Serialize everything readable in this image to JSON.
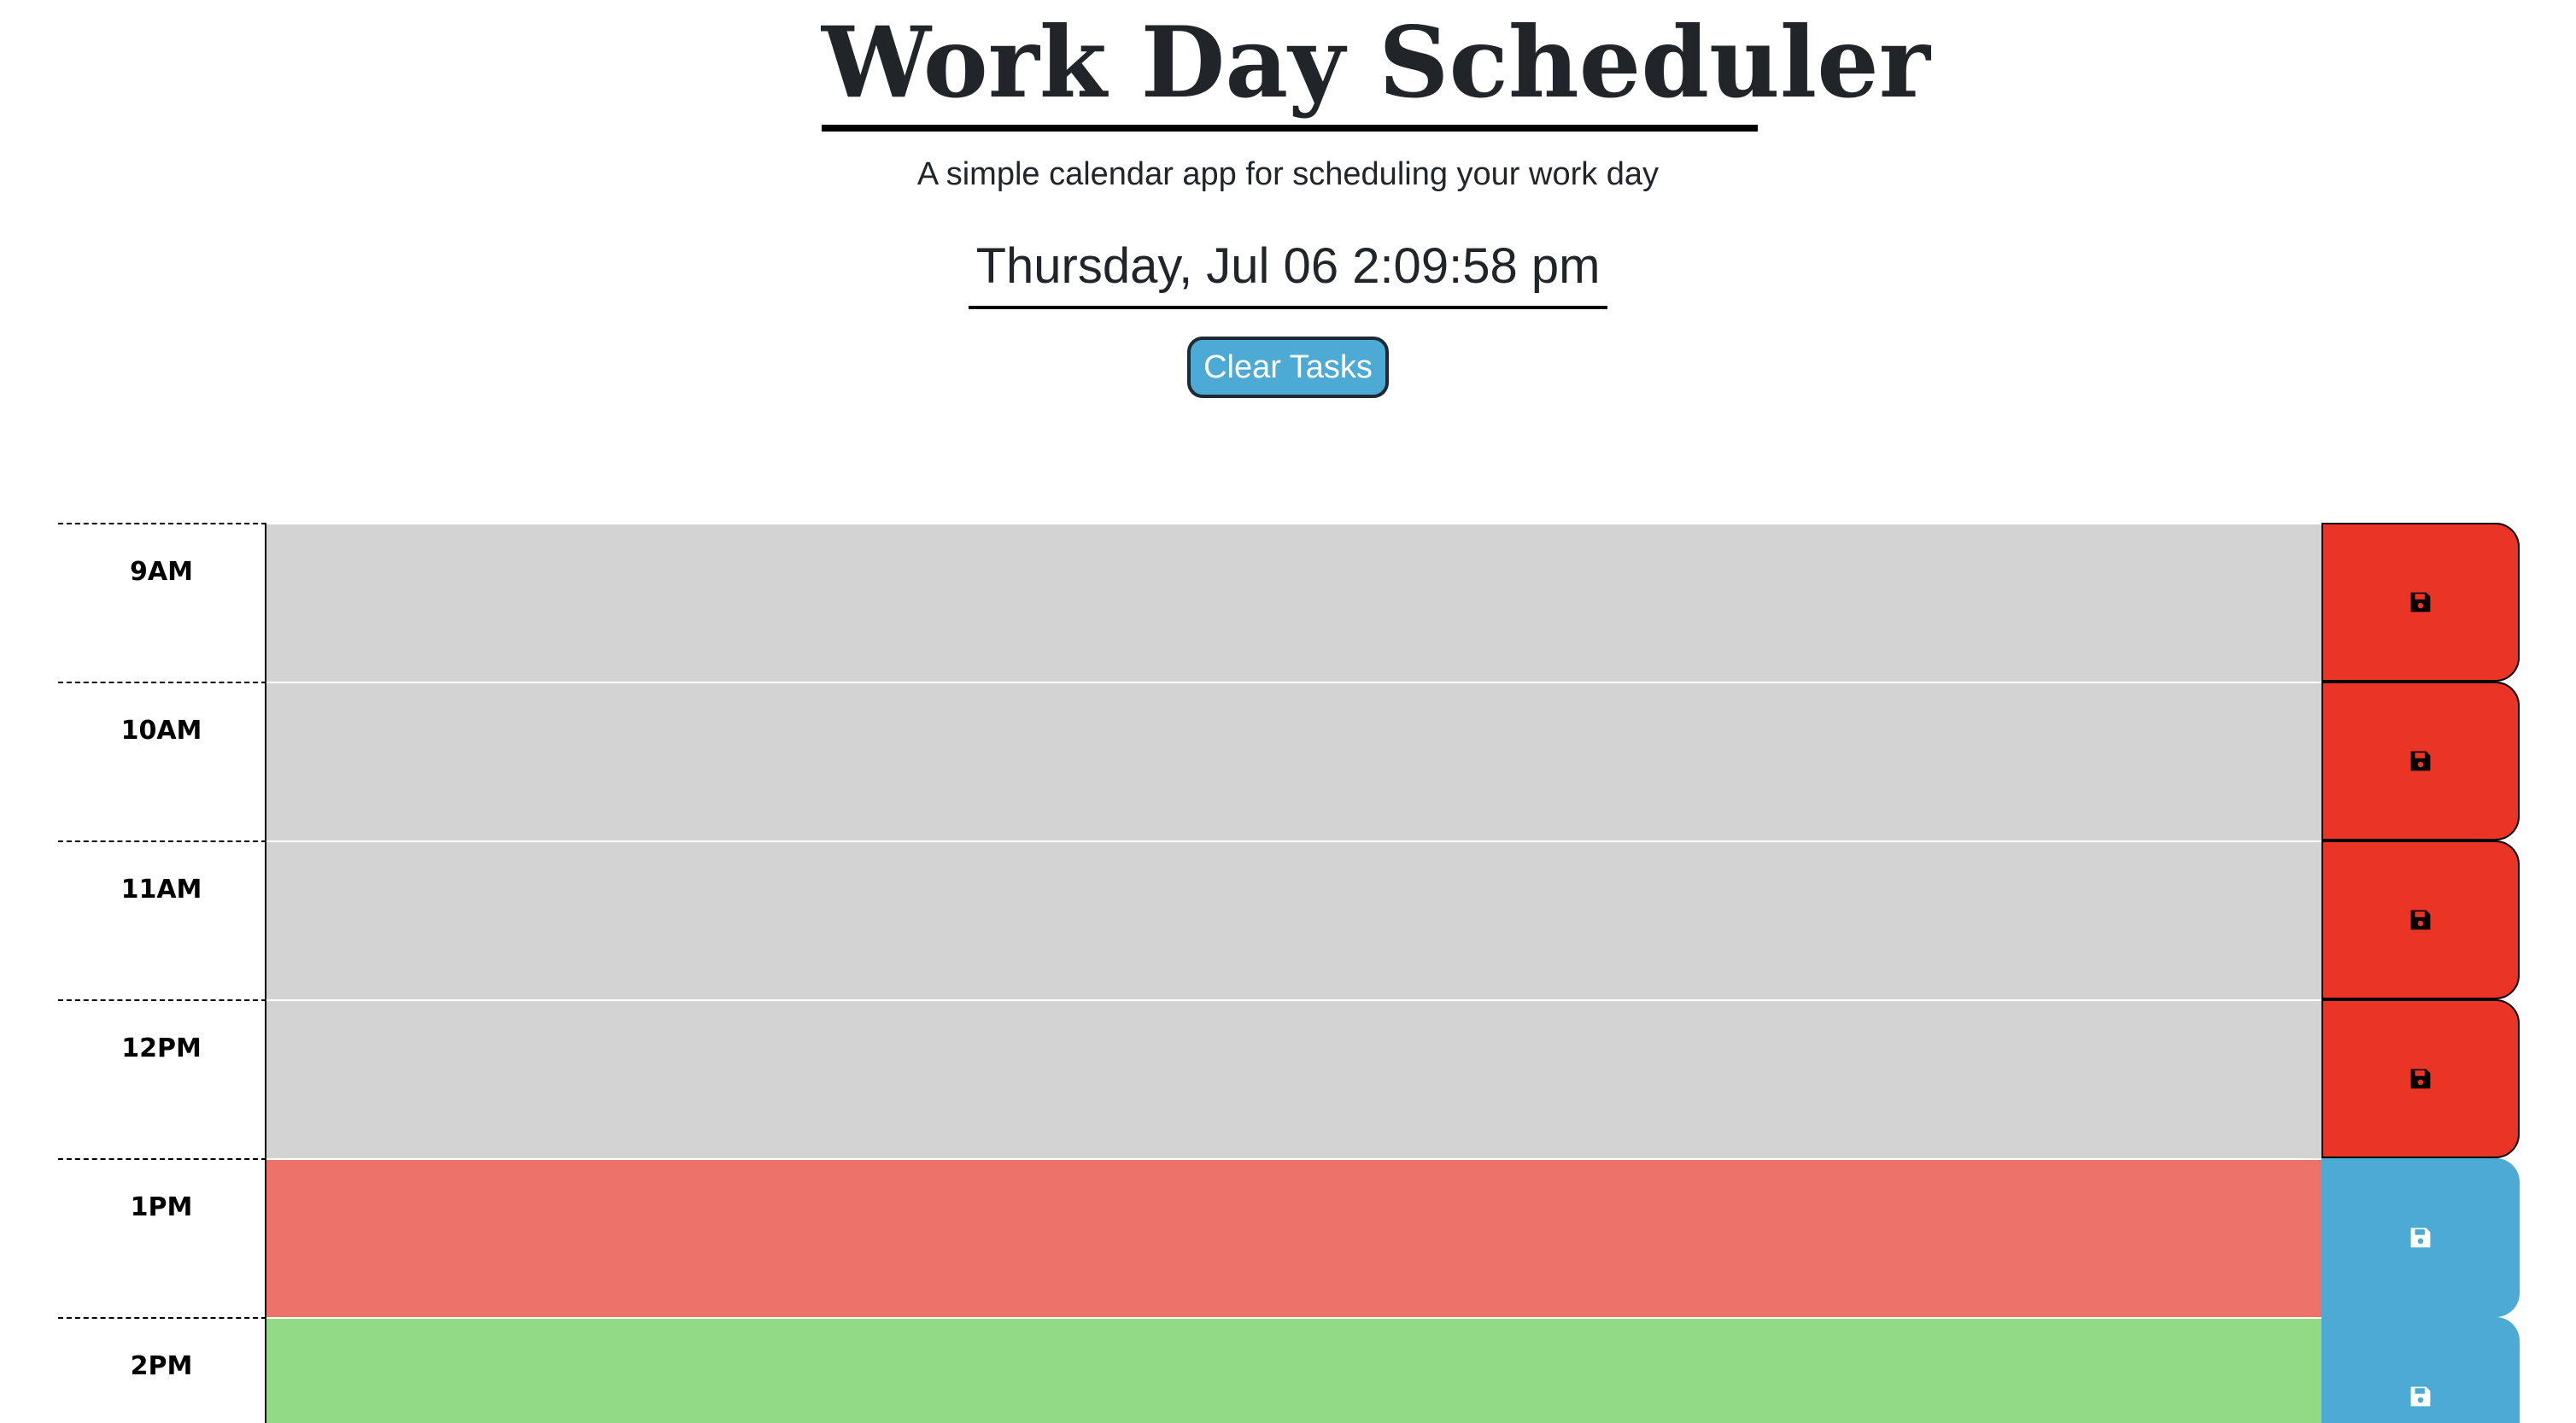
{
  "header": {
    "title": "Work Day Scheduler",
    "subtitle": "A simple calendar app for scheduling your work day",
    "current_day": "Thursday, Jul 06 2:09:58 pm",
    "clear_button_label": "Clear Tasks"
  },
  "schedule": [
    {
      "hour": "9AM",
      "status": "past",
      "text": "",
      "save_color": "#ea3526",
      "icon": "save-icon"
    },
    {
      "hour": "10AM",
      "status": "past",
      "text": "",
      "save_color": "#ea3526",
      "icon": "save-icon"
    },
    {
      "hour": "11AM",
      "status": "past",
      "text": "",
      "save_color": "#ea3526",
      "icon": "save-icon"
    },
    {
      "hour": "12PM",
      "status": "past",
      "text": "",
      "save_color": "#ea3526",
      "icon": "save-icon"
    },
    {
      "hour": "1PM",
      "status": "present",
      "text": "",
      "save_color": "#4daad4",
      "icon": "save-icon"
    },
    {
      "hour": "2PM",
      "status": "future",
      "text": "",
      "save_color": "#4daad4",
      "icon": "save-icon"
    }
  ],
  "colors": {
    "past": "#d3d3d3",
    "present": "#ed7269",
    "future": "#92da85",
    "clear_button": "#4daad4"
  }
}
